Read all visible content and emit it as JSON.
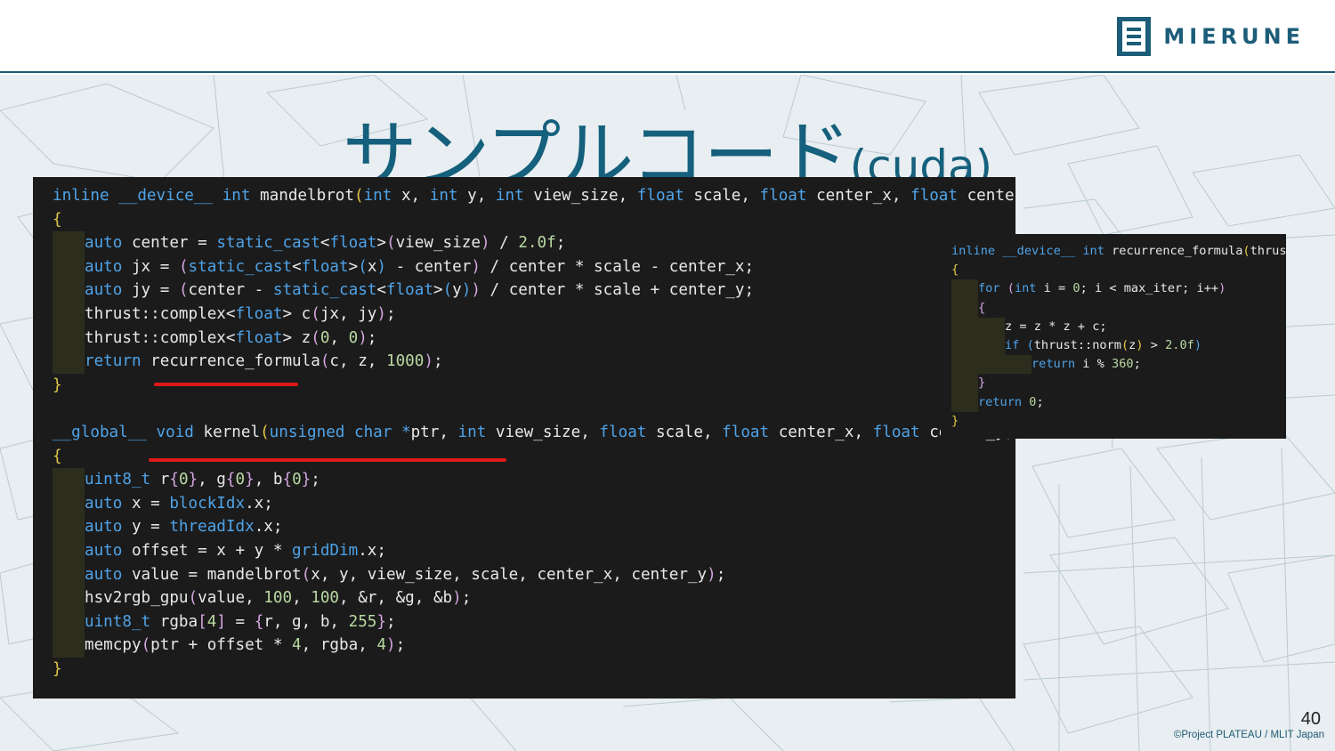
{
  "brand": {
    "name": "MIERUNE",
    "color": "#1c5d79"
  },
  "title": {
    "japanese": "サンプルコード",
    "suffix": "(cuda)"
  },
  "code_main": {
    "lines": [
      {
        "indent": 0,
        "tokens": [
          [
            "k",
            "inline"
          ],
          [
            "t",
            " "
          ],
          [
            "k",
            "__device__"
          ],
          [
            "t",
            " "
          ],
          [
            "k",
            "int"
          ],
          [
            "t",
            " mandelbrot"
          ],
          [
            "p",
            "("
          ],
          [
            "k",
            "int"
          ],
          [
            "t",
            " x, "
          ],
          [
            "k",
            "int"
          ],
          [
            "t",
            " y, "
          ],
          [
            "k",
            "int"
          ],
          [
            "t",
            " view_size, "
          ],
          [
            "k",
            "float"
          ],
          [
            "t",
            " scale, "
          ],
          [
            "k",
            "float"
          ],
          [
            "t",
            " center_x, "
          ],
          [
            "k",
            "float"
          ],
          [
            "t",
            " center_y"
          ],
          [
            "p",
            ")"
          ]
        ]
      },
      {
        "indent": 0,
        "tokens": [
          [
            "p",
            "{"
          ]
        ]
      },
      {
        "indent": 1,
        "tokens": [
          [
            "k",
            "auto"
          ],
          [
            "t",
            " center = "
          ],
          [
            "k",
            "static_cast"
          ],
          [
            "t",
            "<"
          ],
          [
            "k",
            "float"
          ],
          [
            "t",
            ">"
          ],
          [
            "br",
            "("
          ],
          [
            "t",
            "view_size"
          ],
          [
            "br",
            ")"
          ],
          [
            "t",
            " / "
          ],
          [
            "n",
            "2.0f"
          ],
          [
            "t",
            ";"
          ]
        ]
      },
      {
        "indent": 1,
        "tokens": [
          [
            "k",
            "auto"
          ],
          [
            "t",
            " jx = "
          ],
          [
            "br",
            "("
          ],
          [
            "k",
            "static_cast"
          ],
          [
            "t",
            "<"
          ],
          [
            "k",
            "float"
          ],
          [
            "t",
            ">"
          ],
          [
            "k",
            "("
          ],
          [
            "t",
            "x"
          ],
          [
            "k",
            ")"
          ],
          [
            "t",
            " - center"
          ],
          [
            "br",
            ")"
          ],
          [
            "t",
            " / center * scale - center_x;"
          ]
        ]
      },
      {
        "indent": 1,
        "tokens": [
          [
            "k",
            "auto"
          ],
          [
            "t",
            " jy = "
          ],
          [
            "br",
            "("
          ],
          [
            "t",
            "center - "
          ],
          [
            "k",
            "static_cast"
          ],
          [
            "t",
            "<"
          ],
          [
            "k",
            "float"
          ],
          [
            "t",
            ">"
          ],
          [
            "k",
            "("
          ],
          [
            "t",
            "y"
          ],
          [
            "k",
            ")"
          ],
          [
            "br",
            ")"
          ],
          [
            "t",
            " / center * scale + center_y;"
          ]
        ]
      },
      {
        "indent": 1,
        "tokens": [
          [
            "t",
            "thrust::complex<"
          ],
          [
            "k",
            "float"
          ],
          [
            "t",
            "> c"
          ],
          [
            "br",
            "("
          ],
          [
            "t",
            "jx, jy"
          ],
          [
            "br",
            ")"
          ],
          [
            "t",
            ";"
          ]
        ]
      },
      {
        "indent": 1,
        "tokens": [
          [
            "t",
            "thrust::complex<"
          ],
          [
            "k",
            "float"
          ],
          [
            "t",
            "> z"
          ],
          [
            "br",
            "("
          ],
          [
            "n",
            "0"
          ],
          [
            "t",
            ", "
          ],
          [
            "n",
            "0"
          ],
          [
            "br",
            ")"
          ],
          [
            "t",
            ";"
          ]
        ]
      },
      {
        "indent": 1,
        "tokens": [
          [
            "k",
            "return"
          ],
          [
            "t",
            " recurrence_formula"
          ],
          [
            "br",
            "("
          ],
          [
            "t",
            "c, z, "
          ],
          [
            "n",
            "1000"
          ],
          [
            "br",
            ")"
          ],
          [
            "t",
            ";"
          ]
        ]
      },
      {
        "indent": 0,
        "tokens": [
          [
            "p",
            "}"
          ]
        ]
      },
      {
        "indent": 0,
        "tokens": []
      },
      {
        "indent": 0,
        "tokens": [
          [
            "k",
            "__global__"
          ],
          [
            "t",
            " "
          ],
          [
            "k",
            "void"
          ],
          [
            "t",
            " kernel"
          ],
          [
            "p",
            "("
          ],
          [
            "k",
            "unsigned"
          ],
          [
            "t",
            " "
          ],
          [
            "k",
            "char"
          ],
          [
            "t",
            " "
          ],
          [
            "k",
            "*"
          ],
          [
            "t",
            "ptr, "
          ],
          [
            "k",
            "int"
          ],
          [
            "t",
            " view_size, "
          ],
          [
            "k",
            "float"
          ],
          [
            "t",
            " scale, "
          ],
          [
            "k",
            "float"
          ],
          [
            "t",
            " center_x, "
          ],
          [
            "k",
            "float"
          ],
          [
            "t",
            " center_y"
          ],
          [
            "p",
            ")"
          ]
        ]
      },
      {
        "indent": 0,
        "tokens": [
          [
            "p",
            "{"
          ]
        ]
      },
      {
        "indent": 1,
        "tokens": [
          [
            "k",
            "uint8_t"
          ],
          [
            "t",
            " r"
          ],
          [
            "br",
            "{"
          ],
          [
            "n",
            "0"
          ],
          [
            "br",
            "}"
          ],
          [
            "t",
            ", g"
          ],
          [
            "br",
            "{"
          ],
          [
            "n",
            "0"
          ],
          [
            "br",
            "}"
          ],
          [
            "t",
            ", b"
          ],
          [
            "br",
            "{"
          ],
          [
            "n",
            "0"
          ],
          [
            "br",
            "}"
          ],
          [
            "t",
            ";"
          ]
        ]
      },
      {
        "indent": 1,
        "tokens": [
          [
            "k",
            "auto"
          ],
          [
            "t",
            " x = "
          ],
          [
            "k",
            "blockIdx"
          ],
          [
            "t",
            ".x;"
          ]
        ]
      },
      {
        "indent": 1,
        "tokens": [
          [
            "k",
            "auto"
          ],
          [
            "t",
            " y = "
          ],
          [
            "k",
            "threadIdx"
          ],
          [
            "t",
            ".x;"
          ]
        ]
      },
      {
        "indent": 1,
        "tokens": [
          [
            "k",
            "auto"
          ],
          [
            "t",
            " offset = x + y * "
          ],
          [
            "k",
            "gridDim"
          ],
          [
            "t",
            ".x;"
          ]
        ]
      },
      {
        "indent": 1,
        "tokens": [
          [
            "k",
            "auto"
          ],
          [
            "t",
            " value = mandelbrot"
          ],
          [
            "br",
            "("
          ],
          [
            "t",
            "x, y, view_size, scale, center_x, center_y"
          ],
          [
            "br",
            ")"
          ],
          [
            "t",
            ";"
          ]
        ]
      },
      {
        "indent": 1,
        "tokens": [
          [
            "t",
            "hsv2rgb_gpu"
          ],
          [
            "br",
            "("
          ],
          [
            "t",
            "value, "
          ],
          [
            "n",
            "100"
          ],
          [
            "t",
            ", "
          ],
          [
            "n",
            "100"
          ],
          [
            "t",
            ", &r, &g, &b"
          ],
          [
            "br",
            ")"
          ],
          [
            "t",
            ";"
          ]
        ]
      },
      {
        "indent": 1,
        "tokens": [
          [
            "k",
            "uint8_t"
          ],
          [
            "t",
            " rgba"
          ],
          [
            "br",
            "["
          ],
          [
            "n",
            "4"
          ],
          [
            "br",
            "]"
          ],
          [
            "t",
            " = "
          ],
          [
            "br",
            "{"
          ],
          [
            "t",
            "r, g, b, "
          ],
          [
            "n",
            "255"
          ],
          [
            "br",
            "}"
          ],
          [
            "t",
            ";"
          ]
        ]
      },
      {
        "indent": 1,
        "tokens": [
          [
            "t",
            "memcpy"
          ],
          [
            "br",
            "("
          ],
          [
            "t",
            "ptr + offset * "
          ],
          [
            "n",
            "4"
          ],
          [
            "t",
            ", rgba, "
          ],
          [
            "n",
            "4"
          ],
          [
            "br",
            ")"
          ],
          [
            "t",
            ";"
          ]
        ]
      },
      {
        "indent": 0,
        "tokens": [
          [
            "p",
            "}"
          ]
        ]
      }
    ]
  },
  "code_side": {
    "lines": [
      {
        "indent": 0,
        "tokens": [
          [
            "k",
            "inline"
          ],
          [
            "t",
            " "
          ],
          [
            "k",
            "__device__"
          ],
          [
            "t",
            " "
          ],
          [
            "k",
            "int"
          ],
          [
            "t",
            " recurrence_formula"
          ],
          [
            "p",
            "("
          ],
          [
            "t",
            "thrust::"
          ]
        ]
      },
      {
        "indent": 0,
        "tokens": [
          [
            "p",
            "{"
          ]
        ]
      },
      {
        "indent": 1,
        "tokens": [
          [
            "k",
            "for"
          ],
          [
            "t",
            " "
          ],
          [
            "br",
            "("
          ],
          [
            "k",
            "int"
          ],
          [
            "t",
            " i = "
          ],
          [
            "n",
            "0"
          ],
          [
            "t",
            "; i < max_iter; i++"
          ],
          [
            "br",
            ")"
          ]
        ]
      },
      {
        "indent": 1,
        "tokens": [
          [
            "br",
            "{"
          ]
        ]
      },
      {
        "indent": 2,
        "tokens": [
          [
            "t",
            "z = z * z + c;"
          ]
        ]
      },
      {
        "indent": 2,
        "tokens": [
          [
            "k",
            "if"
          ],
          [
            "t",
            " "
          ],
          [
            "k",
            "("
          ],
          [
            "t",
            "thrust::norm"
          ],
          [
            "p",
            "("
          ],
          [
            "t",
            "z"
          ],
          [
            "p",
            ")"
          ],
          [
            "t",
            " > "
          ],
          [
            "n",
            "2.0f"
          ],
          [
            "k",
            ")"
          ]
        ]
      },
      {
        "indent": 3,
        "tokens": [
          [
            "k",
            "return"
          ],
          [
            "t",
            " i % "
          ],
          [
            "n",
            "360"
          ],
          [
            "t",
            ";"
          ]
        ]
      },
      {
        "indent": 1,
        "tokens": [
          [
            "br",
            "}"
          ]
        ]
      },
      {
        "indent": 1,
        "tokens": [
          [
            "k",
            "return"
          ],
          [
            "t",
            " "
          ],
          [
            "n",
            "0"
          ],
          [
            "t",
            ";"
          ]
        ]
      },
      {
        "indent": 0,
        "tokens": [
          [
            "p",
            "}"
          ]
        ]
      }
    ]
  },
  "page_number": "40",
  "copyright": "©Project PLATEAU / MLIT Japan"
}
